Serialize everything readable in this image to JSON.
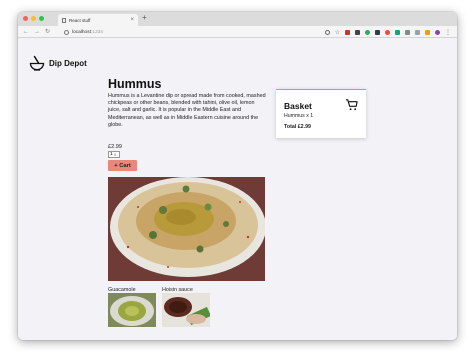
{
  "browser": {
    "tab_title": "React stuff",
    "close_symbol": "×",
    "new_tab_symbol": "+",
    "url_host": "localhost",
    "url_port": ":1234",
    "back_icon": "back-arrow-icon",
    "forward_icon": "forward-arrow-icon",
    "reload_icon": "reload-icon"
  },
  "site": {
    "logo_text": "Dip Depot",
    "logo_icon": "mortar-bowl-icon"
  },
  "product": {
    "title": "Hummus",
    "description": "Hummus is a Levantine dip or spread made from cooked, mashed chickpeas or other beans, blended with tahini, olive oil, lemon juice, salt and garlic. It is popular in the Middle East and Mediterranean, as well as in Middle Eastern cuisine around the globe.",
    "price": "£2.99",
    "quantity": "1",
    "add_button": "+ Cart",
    "accent_color": "#e9877a"
  },
  "related": [
    {
      "name": "Guacamole"
    },
    {
      "name": "Hoisin sauce"
    }
  ],
  "basket": {
    "title": "Basket",
    "icon": "shopping-cart-icon",
    "item": "Hummus x 1",
    "total": "Total £2.99"
  }
}
